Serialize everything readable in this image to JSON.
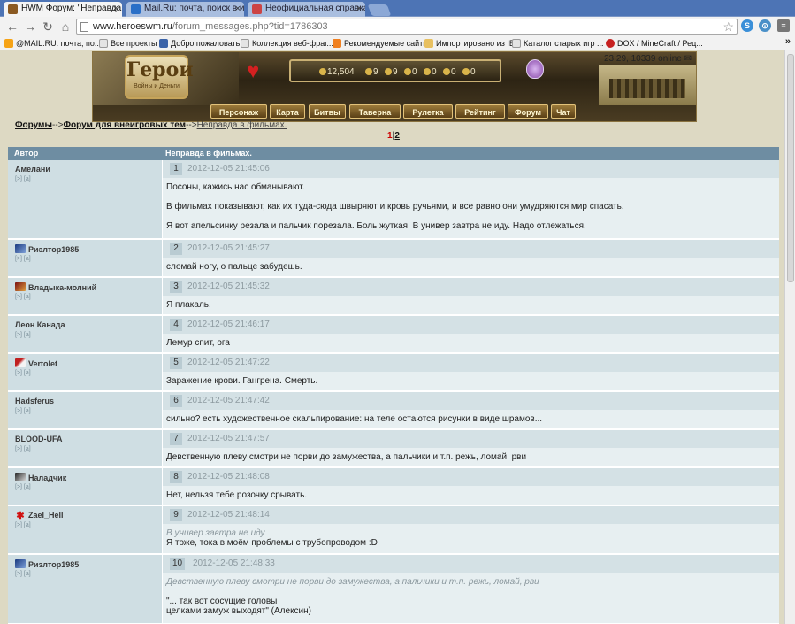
{
  "browser": {
    "tabs": [
      {
        "title": "HWM Форум: \"Неправда в ф",
        "close": "×"
      },
      {
        "title": "Mail.Ru: почта, поиск в инт",
        "close": "×"
      },
      {
        "title": "Неофициальная справка по",
        "close": "×"
      }
    ],
    "url_domain": "www.heroeswm.ru",
    "url_path": "/forum_messages.php?tid=1786303",
    "bookmarks": [
      "@MAIL.RU: почта, по...",
      "Все проекты",
      "Добро пожаловать",
      "Коллекция веб-фраг...",
      "Рекомендуемые сайты",
      "Импортировано из IE",
      "Каталог старых игр ...",
      "DOX / MineCraft / Рец..."
    ],
    "bookmarks_more": "»"
  },
  "game": {
    "logo_text": "Герои",
    "logo_sub": "Войны и Деньги",
    "resources": [
      "12,504",
      "9",
      "9",
      "0",
      "0",
      "0",
      "0"
    ],
    "online_text": "23:29, 10339 online",
    "nav": [
      "Персонаж",
      "Карта",
      "Битвы",
      "Таверна",
      "Рулетка",
      "Рейтинг",
      "Форум",
      "Чат"
    ]
  },
  "forum": {
    "breadcrumb": {
      "root": "Форумы",
      "sep1": "-->",
      "section": "Форум для внеигровых тем",
      "sep2": "-->",
      "topic": "Неправда в фильмах."
    },
    "pages": {
      "current": "1",
      "sep": "|",
      "other": "2"
    },
    "header": {
      "author": "Автор",
      "topic": "Неправда в фильмах."
    },
    "author_links": "[>] [a]",
    "posts": [
      {
        "author": "Амелани",
        "num": "1",
        "date": "2012-12-05 21:45:06",
        "lines": [
          "Посоны, кажись нас обманывают.",
          "",
          "В фильмах показывают, как их туда-сюда швыряют и кровь ручьями, и все равно они умудряются мир спасать.",
          "",
          "Я вот апельсинку резала и пальчик порезала. Боль жуткая. В универ завтра не иду. Надо отлежаться."
        ]
      },
      {
        "author": "Риэлтор1985",
        "num": "2",
        "date": "2012-12-05 21:45:27",
        "lines": [
          "сломай ногу, о пальце забудешь."
        ]
      },
      {
        "author": "Владыка-молний",
        "num": "3",
        "date": "2012-12-05 21:45:32",
        "lines": [
          "Я плакаль."
        ]
      },
      {
        "author": "Леон Канада",
        "num": "4",
        "date": "2012-12-05 21:46:17",
        "lines": [
          "Лемур спит, ога"
        ]
      },
      {
        "author": "Vertolet",
        "num": "5",
        "date": "2012-12-05 21:47:22",
        "lines": [
          "Заражение крови. Гангрена. Смерть."
        ]
      },
      {
        "author": "Hadsferus",
        "num": "6",
        "date": "2012-12-05 21:47:42",
        "lines": [
          "сильно? есть художественное скальпирование: на теле остаются рисунки в виде шрамов..."
        ]
      },
      {
        "author": "BLOOD-UFA",
        "num": "7",
        "date": "2012-12-05 21:47:57",
        "lines": [
          "Девственную плеву смотри не порви до замужества, а пальчики и т.п. режь, ломай, рви"
        ]
      },
      {
        "author": "Наладчик",
        "num": "8",
        "date": "2012-12-05 21:48:08",
        "lines": [
          "Нет, нельзя тебе розочку срывать."
        ]
      },
      {
        "author": "Zael_Hell",
        "num": "9",
        "date": "2012-12-05 21:48:14",
        "quote": "В универ завтра не иду",
        "lines": [
          "Я тоже, тока в моём проблемы с трубопроводом :D"
        ]
      },
      {
        "author": "Риэлтор1985",
        "num": "10",
        "date": "2012-12-05 21:48:33",
        "quote": "Девственную плеву смотри не порви до замужества, а пальчики и т.п. режь, ломай, рви",
        "lines": [
          "",
          "\"... так вот сосущие головы",
          "целками замуж выходят\" (Алексин)"
        ]
      }
    ]
  },
  "colors": {
    "accent": "#6e8da2",
    "author_bg": "#cfdee3",
    "msg_bg": "#e7eff1",
    "page_current": "#cc0000"
  }
}
